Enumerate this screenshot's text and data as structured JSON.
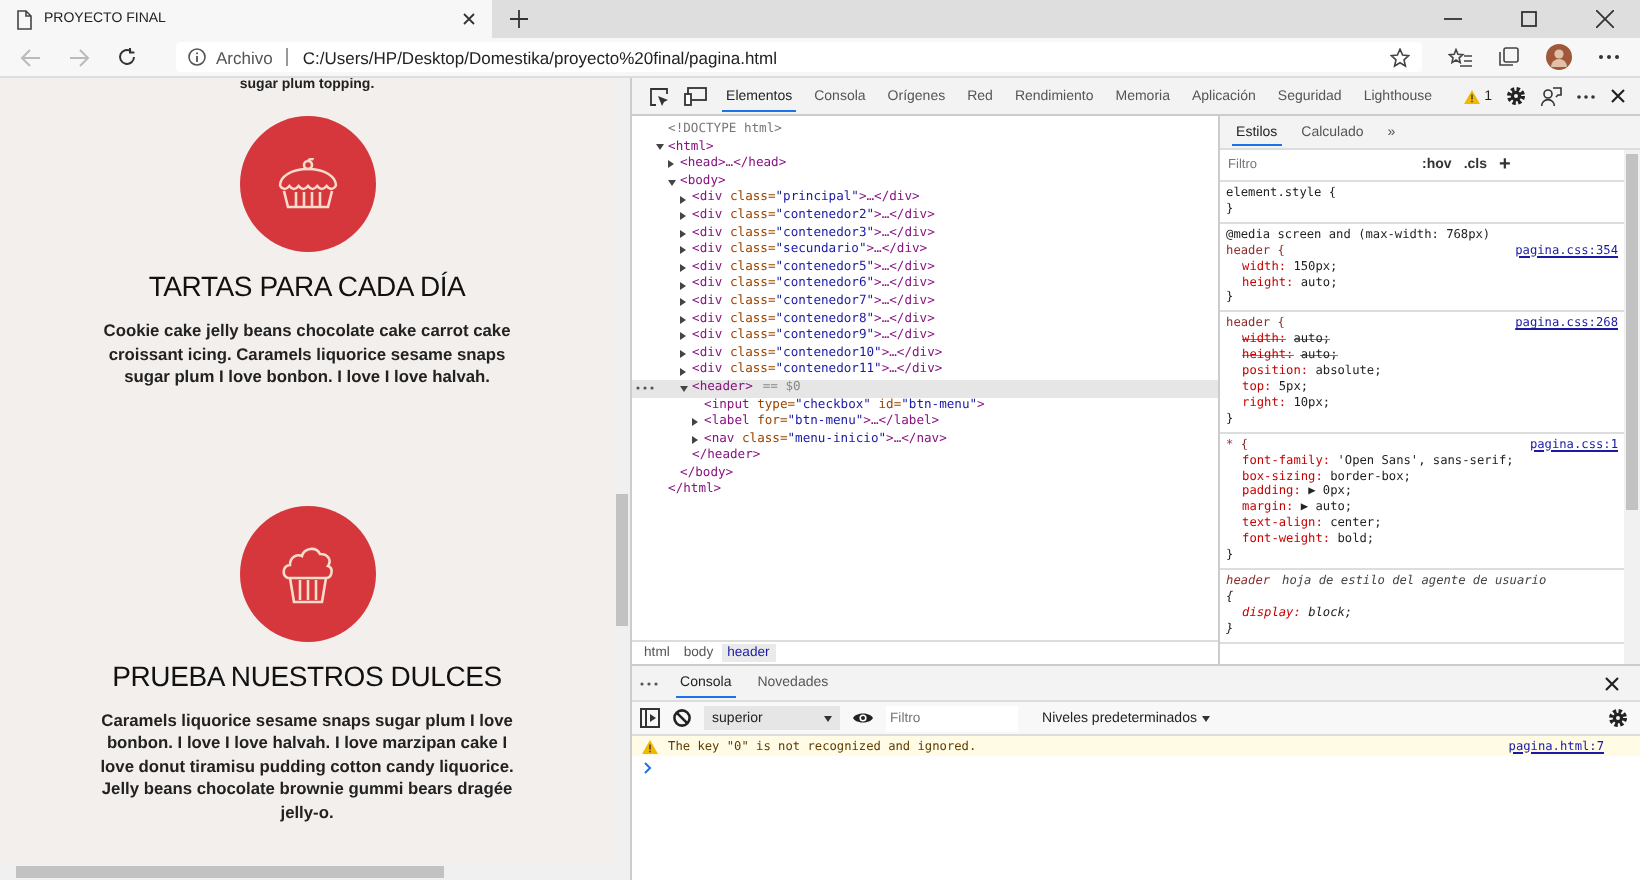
{
  "browser": {
    "tab": {
      "title": "PROYECTO FINAL"
    },
    "address": {
      "scheme_label": "Archivo",
      "url": "C:/Users/HP/Desktop/Domestika/proyecto%20final/pagina.html"
    }
  },
  "page": {
    "top_text": "sugar plum topping.",
    "sections": [
      {
        "kind": "tart",
        "title": "TARTAS PARA CADA DÍA",
        "body": "Cookie cake jelly beans chocolate cake carrot cake croissant icing. Caramels liquorice sesame snaps sugar plum I love bonbon. I love I love halvah."
      },
      {
        "kind": "cupcake",
        "title": "PRUEBA NUESTROS DULCES",
        "body": "Caramels liquorice sesame snaps sugar plum I love bonbon. I love I love halvah. I love marzipan cake I love donut tiramisu pudding cotton candy liquorice. Jelly beans chocolate brownie gummi bears dragée jelly-o."
      }
    ]
  },
  "devtools": {
    "tabs": [
      {
        "label": "Elementos",
        "selected": true
      },
      {
        "label": "Consola",
        "selected": false
      },
      {
        "label": "Orígenes",
        "selected": false
      },
      {
        "label": "Red",
        "selected": false
      },
      {
        "label": "Rendimiento",
        "selected": false
      },
      {
        "label": "Memoria",
        "selected": false
      },
      {
        "label": "Aplicación",
        "selected": false
      },
      {
        "label": "Seguridad",
        "selected": false
      },
      {
        "label": "Lighthouse",
        "selected": false
      }
    ],
    "warning_count": "1",
    "dom": [
      {
        "kind": "doctype",
        "open": "<!DOCTYPE html>",
        "selected": false
      },
      {
        "kind": "element",
        "open": "<html",
        "close": ">",
        "expanded": true,
        "selected": false,
        "end": "</html>",
        "children": [
          {
            "open": "<head",
            "close": ">…</head>",
            "expanded": false,
            "selected": false
          },
          {
            "open": "<body",
            "close": ">",
            "expanded": true,
            "selected": false,
            "end": "</body>",
            "children": [
              {
                "open": "<div",
                "attrs": [
                  {
                    "name": " class=",
                    "value": "\"principal\""
                  }
                ],
                "close": ">…</div>",
                "expanded": false,
                "selected": false
              },
              {
                "open": "<div",
                "attrs": [
                  {
                    "name": " class=",
                    "value": "\"contenedor2\""
                  }
                ],
                "close": ">…</div>",
                "expanded": false,
                "selected": false
              },
              {
                "open": "<div",
                "attrs": [
                  {
                    "name": " class=",
                    "value": "\"contenedor3\""
                  }
                ],
                "close": ">…</div>",
                "expanded": false,
                "selected": false
              },
              {
                "open": "<div",
                "attrs": [
                  {
                    "name": " class=",
                    "value": "\"secundario\""
                  }
                ],
                "close": ">…</div>",
                "expanded": false,
                "selected": false
              },
              {
                "open": "<div",
                "attrs": [
                  {
                    "name": " class=",
                    "value": "\"contenedor5\""
                  }
                ],
                "close": ">…</div>",
                "expanded": false,
                "selected": false
              },
              {
                "open": "<div",
                "attrs": [
                  {
                    "name": " class=",
                    "value": "\"contenedor6\""
                  }
                ],
                "close": ">…</div>",
                "expanded": false,
                "selected": false
              },
              {
                "open": "<div",
                "attrs": [
                  {
                    "name": " class=",
                    "value": "\"contenedor7\""
                  }
                ],
                "close": ">…</div>",
                "expanded": false,
                "selected": false
              },
              {
                "open": "<div",
                "attrs": [
                  {
                    "name": " class=",
                    "value": "\"contenedor8\""
                  }
                ],
                "close": ">…</div>",
                "expanded": false,
                "selected": false
              },
              {
                "open": "<div",
                "attrs": [
                  {
                    "name": " class=",
                    "value": "\"contenedor9\""
                  }
                ],
                "close": ">…</div>",
                "expanded": false,
                "selected": false
              },
              {
                "open": "<div",
                "attrs": [
                  {
                    "name": " class=",
                    "value": "\"contenedor10\""
                  }
                ],
                "close": ">…</div>",
                "expanded": false,
                "selected": false
              },
              {
                "open": "<div",
                "attrs": [
                  {
                    "name": " class=",
                    "value": "\"contenedor11\""
                  }
                ],
                "close": ">…</div>",
                "expanded": false,
                "selected": false
              },
              {
                "open": "<header",
                "close": ">",
                "marker": "== $0",
                "expanded": true,
                "selected": true,
                "end": "</header>",
                "children": [
                  {
                    "open": "<input",
                    "attrs": [
                      {
                        "name": " type=",
                        "value": "\"checkbox\""
                      },
                      {
                        "name": " id=",
                        "value": "\"btn-menu\""
                      }
                    ],
                    "close": ">",
                    "selected": false
                  },
                  {
                    "open": "<label",
                    "attrs": [
                      {
                        "name": " for=",
                        "value": "\"btn-menu\""
                      }
                    ],
                    "close": ">…</label>",
                    "expanded": false,
                    "selected": false
                  },
                  {
                    "open": "<nav",
                    "attrs": [
                      {
                        "name": " class=",
                        "value": "\"menu-inicio\""
                      }
                    ],
                    "close": ">…</nav>",
                    "expanded": false,
                    "selected": false
                  }
                ]
              }
            ]
          }
        ]
      }
    ],
    "breadcrumbs": [
      {
        "label": "html",
        "selected": false
      },
      {
        "label": "body",
        "selected": false
      },
      {
        "label": "header",
        "selected": true
      }
    ],
    "styles": {
      "tabs": [
        {
          "label": "Estilos",
          "selected": true
        },
        {
          "label": "Calculado",
          "selected": false
        }
      ],
      "more": "»",
      "filter_placeholder": "Filtro",
      "hov": ":hov",
      "cls": ".cls",
      "add": "+",
      "rules": [
        {
          "kind": "inline",
          "selector": "element.style {",
          "end": "}"
        },
        {
          "kind": "author",
          "media": "@media screen and (max-width: 768px)",
          "selector": "header {",
          "source": "pagina.css:354",
          "end": "}",
          "declarations": [
            {
              "name": "width:",
              "value": "150px;",
              "struck": false
            },
            {
              "name": "height:",
              "value": "auto;",
              "struck": false
            }
          ]
        },
        {
          "kind": "author",
          "selector": "header {",
          "source": "pagina.css:268",
          "end": "}",
          "declarations": [
            {
              "name": "width:",
              "value": "auto;",
              "struck": true
            },
            {
              "name": "height:",
              "value": "auto;",
              "struck": true
            },
            {
              "name": "position:",
              "value": "absolute;",
              "struck": false
            },
            {
              "name": "top:",
              "value": "5px;",
              "struck": false
            },
            {
              "name": "right:",
              "value": "10px;",
              "struck": false
            }
          ]
        },
        {
          "kind": "author",
          "selector": "* {",
          "source": "pagina.css:1",
          "end": "}",
          "declarations": [
            {
              "name": "font-family:",
              "value": "'Open Sans', sans-serif;",
              "struck": false
            },
            {
              "name": "box-sizing:",
              "value": "border-box;",
              "struck": false
            },
            {
              "name": "padding:",
              "value": "▶ 0px;",
              "struck": false
            },
            {
              "name": "margin:",
              "value": "▶ auto;",
              "struck": false
            },
            {
              "name": "text-align:",
              "value": "center;",
              "struck": false
            },
            {
              "name": "font-weight:",
              "value": "bold;",
              "struck": false
            }
          ]
        },
        {
          "kind": "agent",
          "selector": "header",
          "origin": "hoja de estilo del agente de usuario",
          "brace": "{",
          "end": "}",
          "declarations": [
            {
              "name": "display:",
              "value": "block;",
              "struck": false
            }
          ]
        }
      ]
    },
    "drawer": {
      "tabs": [
        {
          "label": "Consola",
          "selected": true
        },
        {
          "label": "Novedades",
          "selected": false
        }
      ],
      "context": "superior",
      "filter_placeholder": "Filtro",
      "levels": "Niveles predeterminados",
      "messages": [
        {
          "kind": "warning",
          "text": "The key \"0\" is not recognized and ignored.",
          "source": "pagina.html:7"
        }
      ]
    }
  }
}
